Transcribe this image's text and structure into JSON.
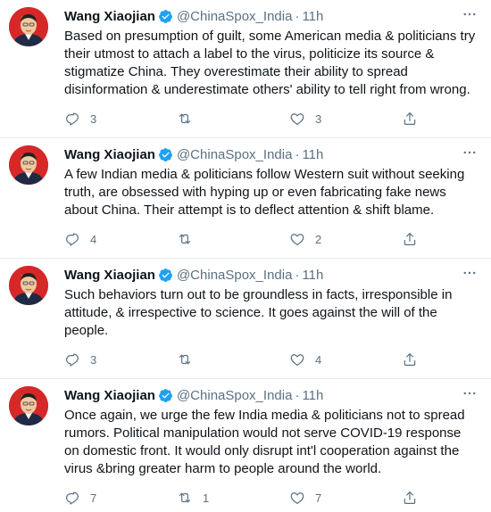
{
  "tweets": [
    {
      "author": "Wang Xiaojian",
      "handle": "@ChinaSpox_India",
      "separator": "·",
      "time": "11h",
      "text": "Based on presumption of guilt, some American media & politicians try their utmost to attach a label to the virus, politicize its source & stigmatize China. They overestimate their ability to spread disinformation & underestimate others' ability to tell right from wrong.",
      "replies": "3",
      "retweets": "",
      "likes": "3"
    },
    {
      "author": "Wang Xiaojian",
      "handle": "@ChinaSpox_India",
      "separator": "·",
      "time": "11h",
      "text": "A few Indian media & politicians follow Western suit without seeking truth, are obsessed with hyping up or even fabricating fake news about China. Their attempt is to deflect attention & shift blame.",
      "replies": "4",
      "retweets": "",
      "likes": "2"
    },
    {
      "author": "Wang Xiaojian",
      "handle": "@ChinaSpox_India",
      "separator": "·",
      "time": "11h",
      "text": "Such behaviors turn out to be groundless in facts, irresponsible in attitude, & irrespective to science. It goes against the will of the people.",
      "replies": "3",
      "retweets": "",
      "likes": "4"
    },
    {
      "author": "Wang Xiaojian",
      "handle": "@ChinaSpox_India",
      "separator": "·",
      "time": "11h",
      "text": "Once again, we urge the few India media & politicians not to spread rumors. Political manipulation would not serve COVID-19 response on domestic front. It would only disrupt int'l cooperation against the virus &bring greater harm to people around the world.",
      "replies": "7",
      "retweets": "1",
      "likes": "7"
    }
  ],
  "colors": {
    "text": "#0f1419",
    "secondary": "#5b7083",
    "verified": "#1da1f2",
    "divider": "#e6ecf0",
    "avatar_bg": "#d62828"
  },
  "icons": [
    "verified-badge-icon",
    "more-icon",
    "reply-icon",
    "retweet-icon",
    "like-icon",
    "share-icon"
  ]
}
